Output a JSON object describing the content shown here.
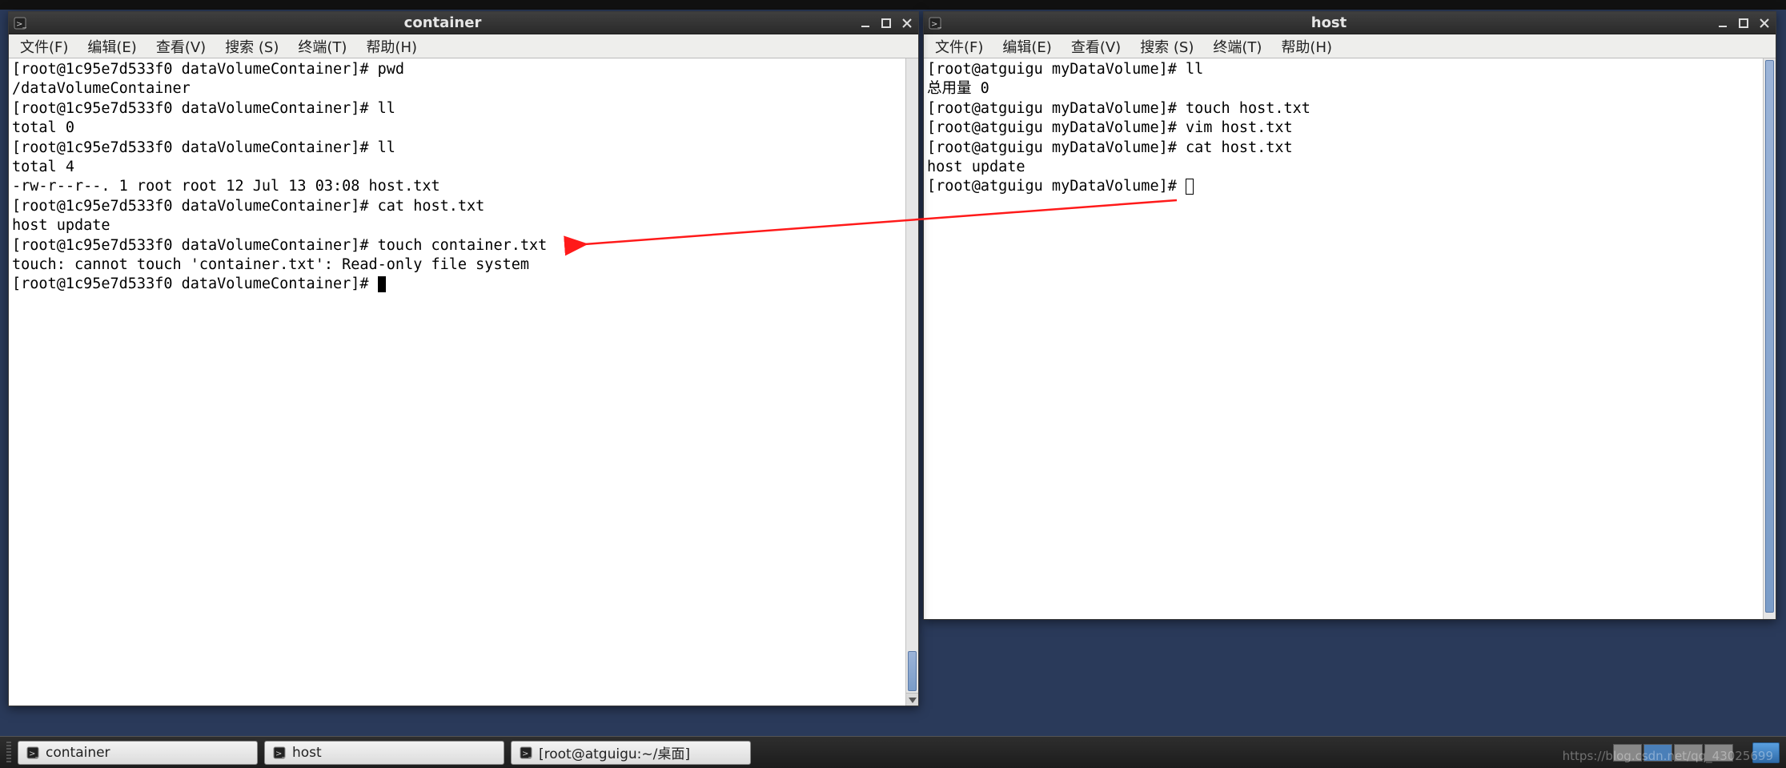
{
  "panel_top": {},
  "windows": {
    "left": {
      "title": "container",
      "menus": [
        "文件(F)",
        "编辑(E)",
        "查看(V)",
        "搜索 (S)",
        "终端(T)",
        "帮助(H)"
      ],
      "lines": [
        "[root@1c95e7d533f0 dataVolumeContainer]# pwd",
        "/dataVolumeContainer",
        "[root@1c95e7d533f0 dataVolumeContainer]# ll",
        "total 0",
        "[root@1c95e7d533f0 dataVolumeContainer]# ll",
        "total 4",
        "-rw-r--r--. 1 root root 12 Jul 13 03:08 host.txt",
        "[root@1c95e7d533f0 dataVolumeContainer]# cat host.txt",
        "host update",
        "[root@1c95e7d533f0 dataVolumeContainer]# touch container.txt",
        "touch: cannot touch 'container.txt': Read-only file system",
        "[root@1c95e7d533f0 dataVolumeContainer]# "
      ],
      "cursor": "block"
    },
    "right": {
      "title": "host",
      "menus": [
        "文件(F)",
        "编辑(E)",
        "查看(V)",
        "搜索 (S)",
        "终端(T)",
        "帮助(H)"
      ],
      "lines": [
        "[root@atguigu myDataVolume]# ll",
        "总用量 0",
        "[root@atguigu myDataVolume]# touch host.txt",
        "[root@atguigu myDataVolume]# vim host.txt",
        "[root@atguigu myDataVolume]# cat host.txt",
        "host update",
        "[root@atguigu myDataVolume]# "
      ],
      "cursor": "hollow"
    }
  },
  "taskbar": {
    "items": [
      {
        "label": "container"
      },
      {
        "label": "host"
      },
      {
        "label": "[root@atguigu:~/桌面]"
      }
    ]
  },
  "annotation": {
    "color": "#ff1a1a"
  },
  "watermark": "https://blog.csdn.net/qq_43025699"
}
